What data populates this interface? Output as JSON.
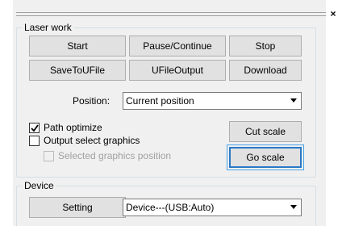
{
  "laser_work": {
    "title": "Laser work",
    "start_label": "Start",
    "pause_label": "Pause/Continue",
    "stop_label": "Stop",
    "save_label": "SaveToUFile",
    "ufile_label": "UFileOutput",
    "download_label": "Download",
    "position_label": "Position:",
    "position_value": "Current position",
    "path_optimize_label": "Path optimize",
    "path_optimize_checked": true,
    "output_select_label": "Output select graphics",
    "output_select_checked": false,
    "selected_pos_label": "Selected graphics position",
    "selected_pos_checked": false,
    "cut_scale_label": "Cut scale",
    "go_scale_label": "Go scale"
  },
  "device": {
    "title": "Device",
    "setting_label": "Setting",
    "device_value": "Device---(USB:Auto)"
  },
  "window": {
    "close_symbol": "×"
  }
}
